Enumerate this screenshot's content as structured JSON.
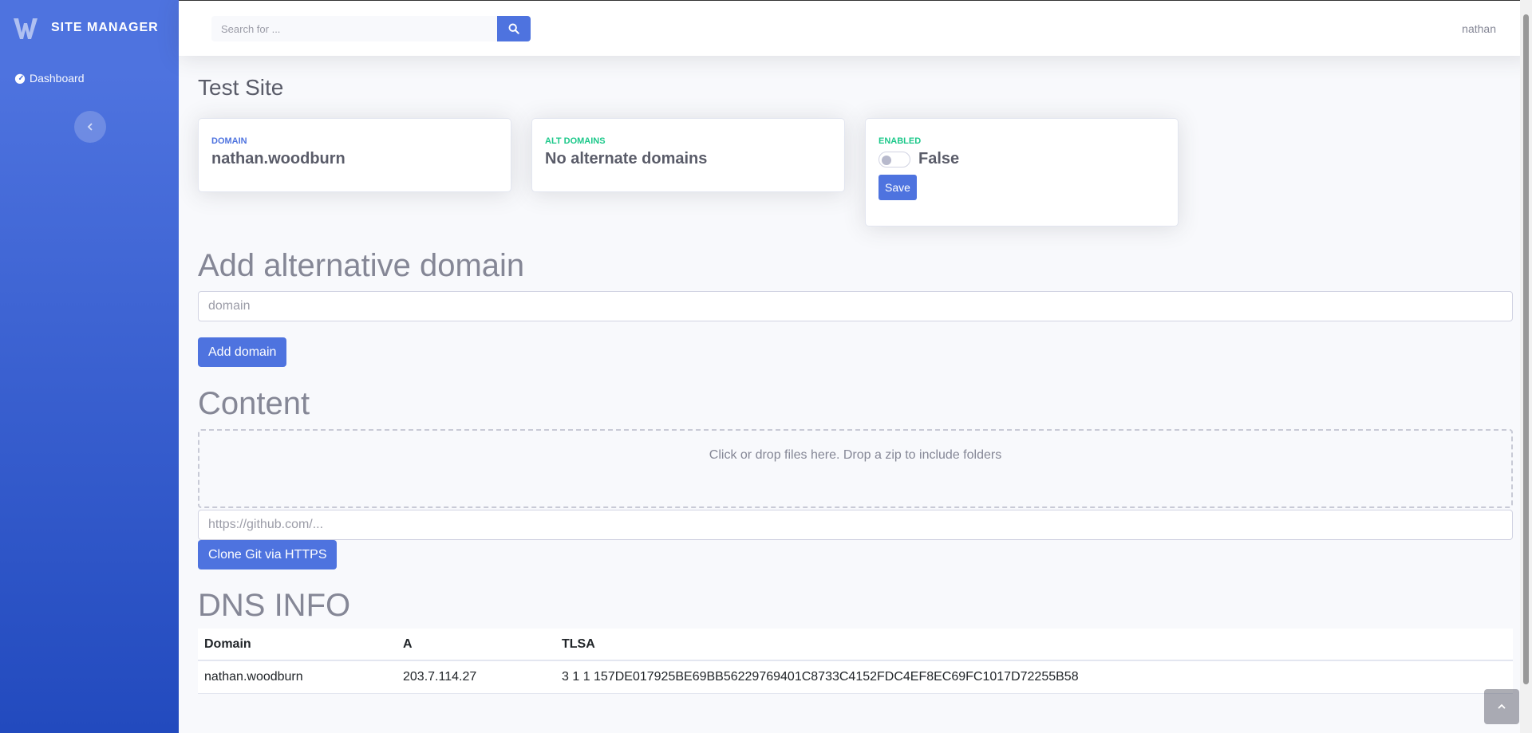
{
  "app": {
    "brand": "Site Manager",
    "user": "nathan"
  },
  "sidebar": {
    "items": [
      {
        "label": "Dashboard",
        "icon": "tachometer-icon"
      }
    ]
  },
  "search": {
    "placeholder": "Search for ..."
  },
  "page": {
    "title": "Test Site"
  },
  "cards": {
    "domain": {
      "label": "Domain",
      "value": "nathan.woodburn"
    },
    "alt_domains": {
      "label": "Alt Domains",
      "value": "No alternate domains"
    },
    "enabled": {
      "label": "Enabled",
      "value": "False",
      "checked": false,
      "save_label": "Save"
    }
  },
  "alt_domain_form": {
    "title": "Add alternative domain",
    "placeholder": "domain",
    "button": "Add domain"
  },
  "content": {
    "title": "Content",
    "dropzone_text": "Click or drop files here. Drop a zip to include folders",
    "git_placeholder": "https://github.com/...",
    "git_button": "Clone Git via HTTPS"
  },
  "dns": {
    "title": "DNS INFO",
    "columns": [
      "Domain",
      "A",
      "TLSA"
    ],
    "rows": [
      [
        "nathan.woodburn",
        "203.7.114.27",
        "3 1 1 157DE017925BE69BB56229769401C8733C4152FDC4EF8EC69FC1017D72255B58"
      ]
    ]
  },
  "colors": {
    "primary": "#4e73df",
    "success": "#1cc88a",
    "sidebar_dark": "#224abe"
  }
}
